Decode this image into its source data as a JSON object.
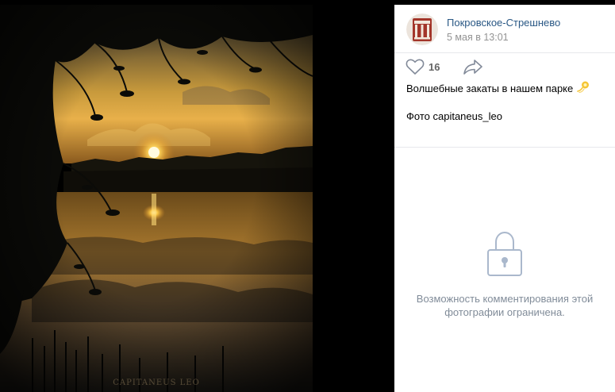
{
  "post": {
    "author": "Покровское-Стрешнево",
    "date": "5 мая в 13:01",
    "likes": "16",
    "caption_line1": "Волшебные закаты в нашем парке",
    "caption_line2": "Фото capitaneus_leo"
  },
  "photo": {
    "watermark": "CAPITANEUS LEO"
  },
  "comments": {
    "locked_message": "Возможность комментирования этой фотографии ограничена."
  },
  "icons": {
    "avatar_logo": "pavilion-logo",
    "like": "heart-icon",
    "share": "share-arrow-icon",
    "emoji": "dizzy-emoji-icon",
    "lock": "lock-icon"
  },
  "colors": {
    "link": "#2a5885",
    "muted": "#939393",
    "icon": "#828a99",
    "lock": "#aab8cc",
    "avatar_bg": "#a3352a"
  }
}
